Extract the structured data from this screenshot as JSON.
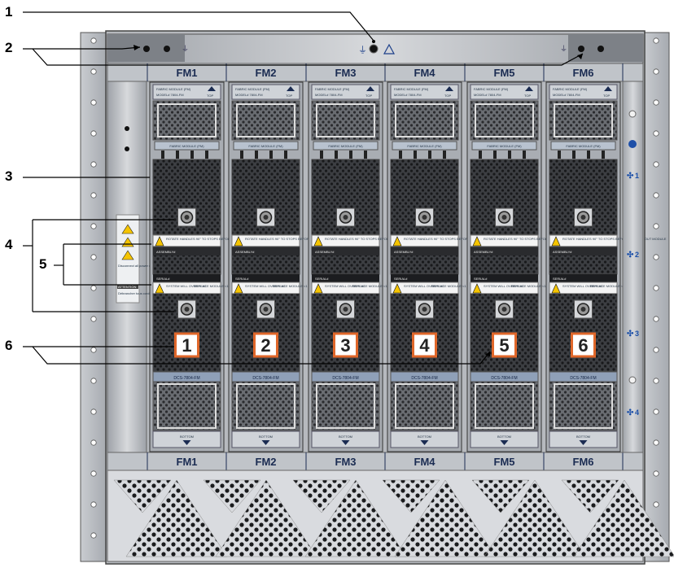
{
  "callouts": [
    "1",
    "2",
    "3",
    "4",
    "5",
    "6"
  ],
  "slot_labels": [
    "FM1",
    "FM2",
    "FM3",
    "FM4",
    "FM5",
    "FM6"
  ],
  "slot_numbers": [
    "1",
    "2",
    "3",
    "4",
    "5",
    "6"
  ],
  "module": {
    "top_label": "FABRIC MODULE (FM)",
    "model": "MODEL# 7804-FM",
    "top": "TOP",
    "mid_label": "FABRIC MODULE (FM)",
    "serial": "SERIAL#",
    "assembly": "ASSEMBLY#",
    "warning_text": "ROTATE HANDLES 90° TO STOPS BEFORE PULLING OUT MODULE",
    "status_text": "SYSTEM WILL OVERHEAT",
    "replace_text": "REPLACE MODULE <1 min.",
    "handle_label": "DCS-7804-FM",
    "bottom": "BOTTOM"
  },
  "left_panel": {
    "text1": "Disconnect all power cords to remove power.",
    "attention": "ATTENTION",
    "text2": "Débrancher tous cordons d'alimentation pour couper l'alimentation."
  },
  "fan_labels": [
    "1",
    "2",
    "3",
    "4"
  ],
  "colors": {
    "chassis": "#b9bdc3",
    "label_blue": "#1b2c52",
    "tile_orange": "#e0672a",
    "warning_yellow": "#f5c400"
  }
}
